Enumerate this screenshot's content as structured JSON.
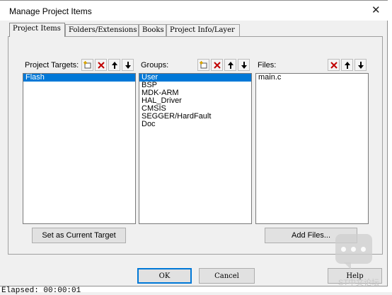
{
  "window": {
    "title": "Manage Project Items",
    "close_glyph": "✕"
  },
  "tabs": [
    {
      "label": "Project Items",
      "active": true
    },
    {
      "label": "Folders/Extensions",
      "active": false
    },
    {
      "label": "Books",
      "active": false
    },
    {
      "label": "Project Info/Layer",
      "active": false
    }
  ],
  "targets": {
    "label": "Project Targets:",
    "items": [
      "Flash"
    ],
    "selected": "Flash"
  },
  "groups": {
    "label": "Groups:",
    "items": [
      "User",
      "BSP",
      "MDK-ARM",
      "HAL_Driver",
      "CMSIS",
      "SEGGER/HardFault",
      "Doc"
    ],
    "selected": "User"
  },
  "files": {
    "label": "Files:",
    "items": [
      "main.c"
    ]
  },
  "toolbar_icons": {
    "new": "new-item-icon",
    "delete": "delete-icon",
    "up": "move-up-icon",
    "down": "move-down-icon",
    "delete_color": "#c00000"
  },
  "buttons": {
    "set_current_target": "Set as Current Target",
    "add_files": "Add Files...",
    "ok": "OK",
    "cancel": "Cancel",
    "help": "Help"
  },
  "background": {
    "elapsed_text": "  Elapsed:  00:00:01"
  },
  "watermark": "ST中文论坛",
  "colors": {
    "selection": "#0078d7",
    "dialog_bg": "#f0f0f0"
  }
}
